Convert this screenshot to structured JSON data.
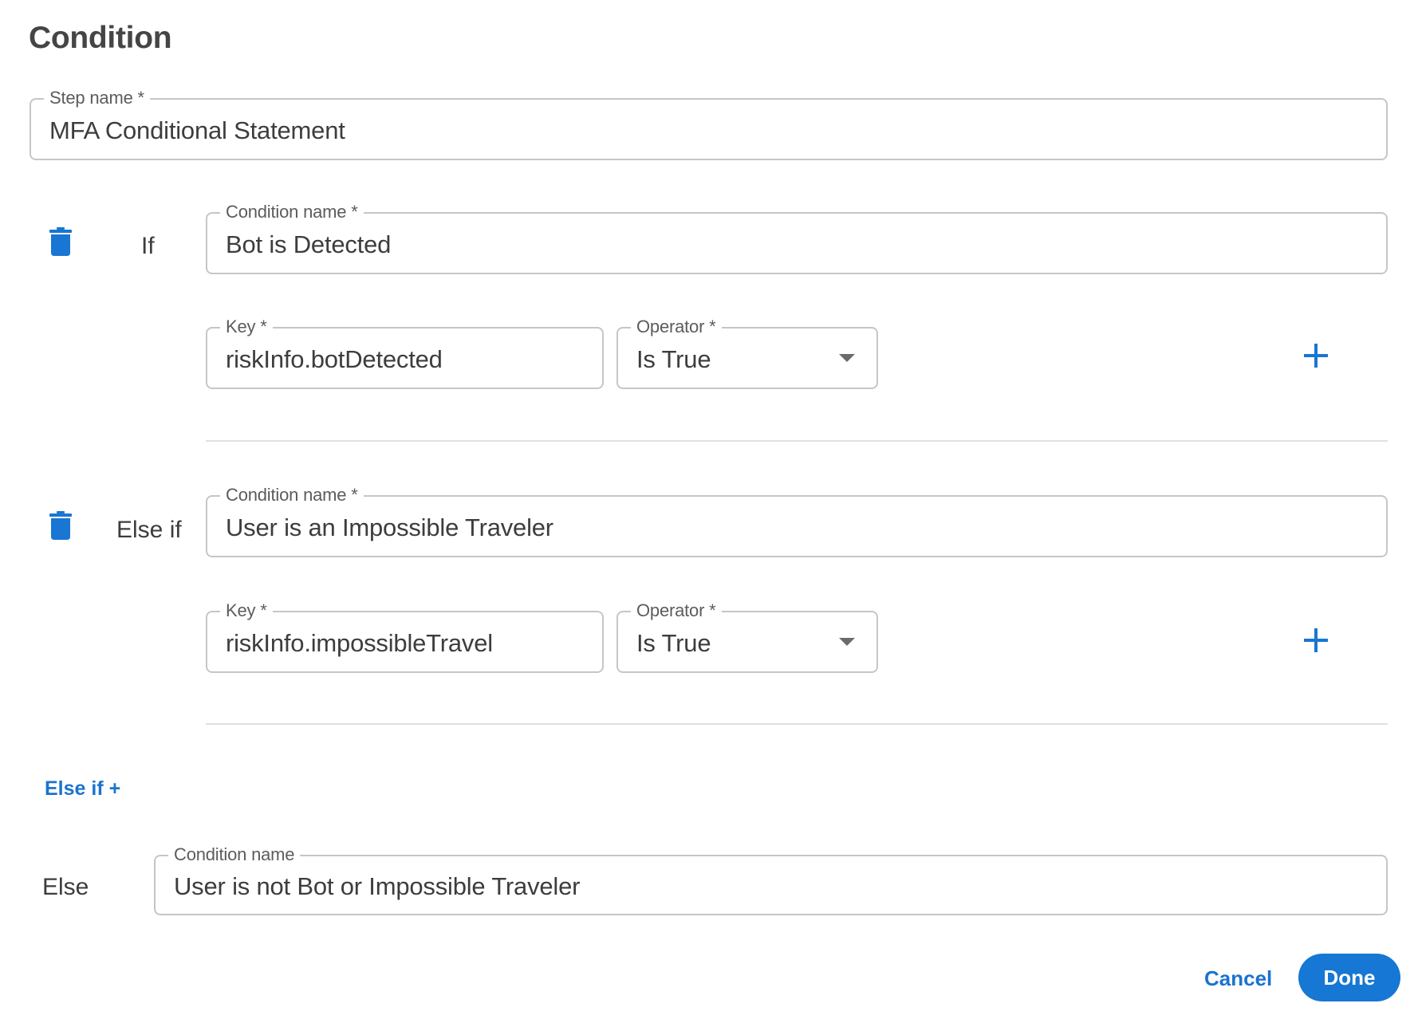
{
  "dialog": {
    "title": "Condition"
  },
  "step_name": {
    "label": "Step name *",
    "value": "MFA Conditional Statement"
  },
  "conditions": [
    {
      "type_label": "If",
      "delete_icon": "trash-icon",
      "condition_name": {
        "label": "Condition name *",
        "value": "Bot is Detected"
      },
      "key": {
        "label": "Key *",
        "value": "riskInfo.botDetected"
      },
      "operator": {
        "label": "Operator *",
        "value": "Is True",
        "icon": "caret-down-icon"
      },
      "add_icon": "plus-icon"
    },
    {
      "type_label": "Else if",
      "delete_icon": "trash-icon",
      "condition_name": {
        "label": "Condition name *",
        "value": "User is an Impossible Traveler"
      },
      "key": {
        "label": "Key *",
        "value": "riskInfo.impossibleTravel"
      },
      "operator": {
        "label": "Operator *",
        "value": "Is True",
        "icon": "caret-down-icon"
      },
      "add_icon": "plus-icon"
    }
  ],
  "add_else_if": {
    "label": "Else if +"
  },
  "else_block": {
    "type_label": "Else",
    "condition_name": {
      "label": "Condition name",
      "value": "User is not Bot or Impossible Traveler"
    }
  },
  "footer": {
    "cancel_label": "Cancel",
    "done_label": "Done"
  },
  "colors": {
    "accent": "#1677d4",
    "link": "#1a73cf",
    "border": "#c6c6c6",
    "divider": "#e0e0e0",
    "text": "#3d3d3d"
  }
}
